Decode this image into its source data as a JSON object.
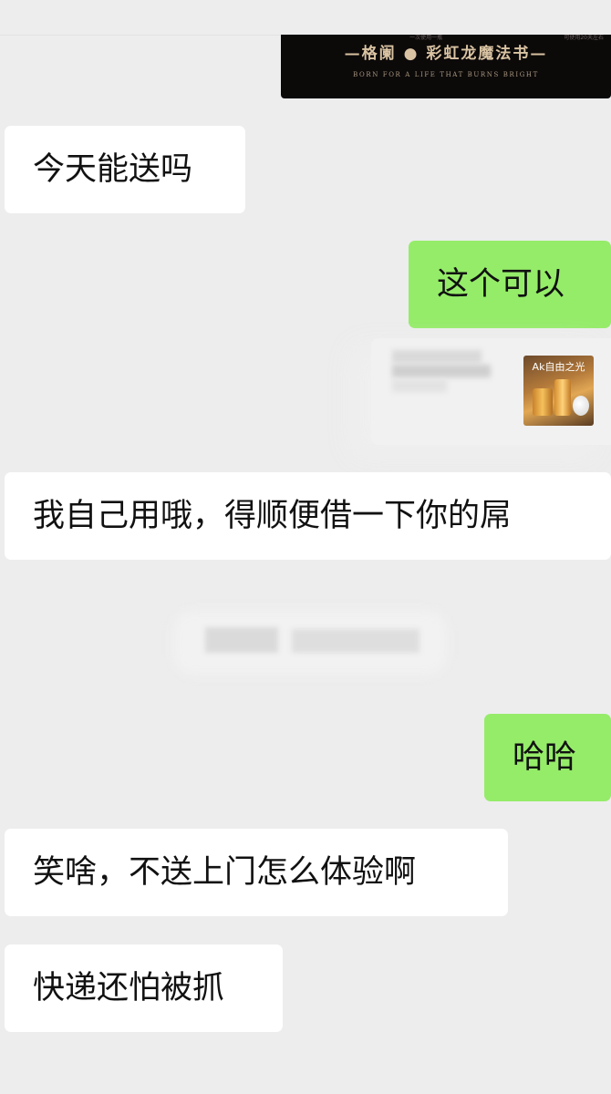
{
  "banner": {
    "top_left": "",
    "top_mid": "一次使用一瓶",
    "top_right": "可使用20天左右",
    "title": "—格阑 ● 彩虹龙魔法书—",
    "subtitle": "BORN FOR A LIFE THAT BURNS BRIGHT"
  },
  "messages": [
    {
      "side": "received",
      "text": "今天能送吗"
    },
    {
      "side": "sent",
      "text": "这个可以"
    },
    {
      "side": "received",
      "text": "我自己用哦，得顺便借一下你的屌"
    },
    {
      "side": "sent",
      "text": "哈哈"
    },
    {
      "side": "received",
      "text": "笑啥，不送上门怎么体验啊"
    },
    {
      "side": "received",
      "text": "快递还怕被抓"
    }
  ],
  "product_card": {
    "thumb_label": "Ak自由之光",
    "thumb_icon": "cosmetic-jars-image"
  },
  "colors": {
    "background": "#ededed",
    "sent_bubble": "#95ec69",
    "received_bubble": "#ffffff"
  }
}
